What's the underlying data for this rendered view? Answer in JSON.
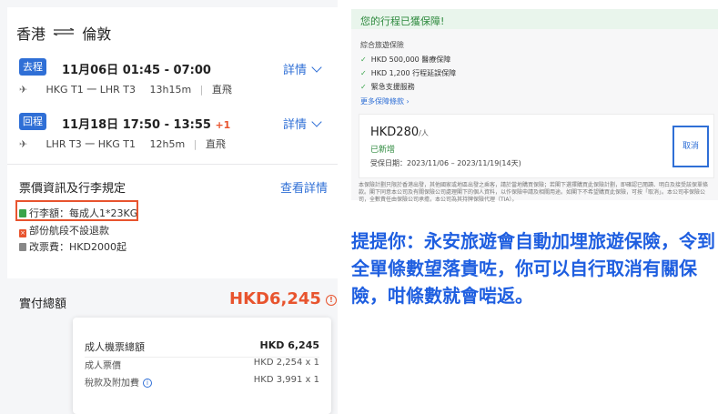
{
  "route": {
    "origin": "香港",
    "destination": "倫敦"
  },
  "outbound": {
    "badge": "去程",
    "datetime": "11月06日 01:45 - 07:00",
    "details": "詳情",
    "route_info": "HKG T1 一 LHR T3",
    "duration": "13h15m",
    "type": "直飛"
  },
  "inbound": {
    "badge": "回程",
    "datetime": "11月18日 17:50 - 13:55",
    "plus_day": "+1",
    "details": "詳情",
    "route_info": "LHR T3 一 HKG T1",
    "duration": "12h5m",
    "type": "直飛"
  },
  "fare": {
    "title": "票價資訊及行李規定",
    "check_all": "查看詳情",
    "baggage": "行李額：每成人1*23KG",
    "refund": "部份航段不設退款",
    "change_fee": "改票費：HKD2000起"
  },
  "total": {
    "label": "實付總額",
    "value": "HKD6,245",
    "info_icon": "!"
  },
  "breakdown": {
    "rows": [
      {
        "label": "成人機票總額",
        "value": "HKD 6,245"
      },
      {
        "label": "成人票價",
        "value": "HKD 2,254 x 1"
      },
      {
        "label": "稅款及附加費",
        "value": "HKD 3,991 x 1"
      }
    ],
    "info_icon": "i"
  },
  "insurance": {
    "header": "您的行程已獲保障!",
    "subtitle": "綜合旅遊保險",
    "items": [
      "HKD 500,000 醫療保障",
      "HKD 1,200 行程延誤保障",
      "緊急支援服務"
    ],
    "more": "更多保障條款",
    "price": "HKD280",
    "per": "/人",
    "added": "已新增",
    "period": "受保日期：2023/11/06 – 2023/11/19(14天)",
    "cancel": "取消",
    "disclaimer": "本保險計劃只限於香港出發，其他國家或地區出發之乘客，請於當地購買保險；若閣下選擇購買此保險計劃，即確認已閱讀、明白及接受該保單條款。閣下同意本公司及有關保險公司處理閣下的個人資料，以作保險申請及相關用途。如閣下不希望購買此保險，可按「取消」。本公司非保險公司，全數責任由保險公司承擔，本公司為其持牌保險代理（TIA）。"
  },
  "caption": "提提你：永安旅遊會自動加埋旅遊保險，令到全單條數望落貴咗，你可以自行取消有關保險，咁條數就會啱返。",
  "colors": {
    "accent": "#2f6fd6",
    "price": "#e8542e",
    "green": "#2e8a3e",
    "caption": "#1f5fe0"
  }
}
